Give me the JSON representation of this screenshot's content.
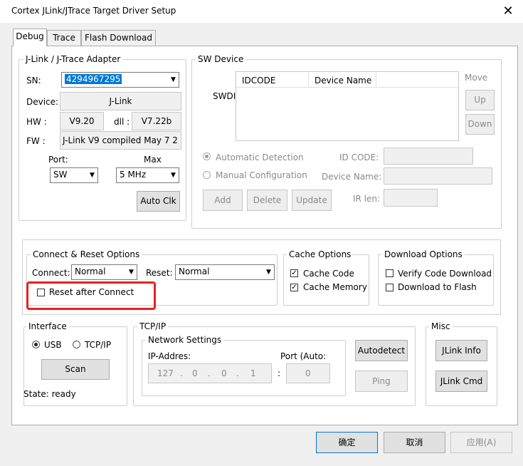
{
  "window": {
    "title": "Cortex JLink/JTrace Target Driver Setup"
  },
  "tabs": [
    {
      "label": "Debug"
    },
    {
      "label": "Trace"
    },
    {
      "label": "Flash Download"
    }
  ],
  "adapter": {
    "title": "J-Link / J-Trace Adapter",
    "sn_label": "SN:",
    "sn_value": "4294967295",
    "device_label": "Device:",
    "device_value": "J-Link",
    "hw_label": "HW :",
    "hw_value": "V9.20",
    "dll_label": "dll :",
    "dll_value": "V7.22b",
    "fw_label": "FW :",
    "fw_value": "J-Link V9 compiled May  7 2",
    "port_label": "Port:",
    "port_value": "SW",
    "max_label": "Max",
    "max_value": "5 MHz",
    "autoclk": "Auto Clk"
  },
  "sw_device": {
    "title": "SW Device",
    "swdi_label": "SWDI",
    "col_idcode": "IDCODE",
    "col_device": "Device Name",
    "move_label": "Move",
    "up": "Up",
    "down": "Down",
    "auto_detect": "Automatic Detection",
    "manual_config": "Manual Configuration",
    "id_code_label": "ID CODE:",
    "device_name_label": "Device Name:",
    "ir_len_label": "IR len:",
    "add": "Add",
    "delete": "Delete",
    "update": "Update"
  },
  "connect_reset": {
    "title": "Connect & Reset Options",
    "connect_label": "Connect:",
    "connect_value": "Normal",
    "reset_label": "Reset:",
    "reset_value": "Normal",
    "reset_after_connect": "Reset after Connect",
    "reset_after_connect_checked": false
  },
  "cache": {
    "title": "Cache Options",
    "cache_code": "Cache Code",
    "cache_code_checked": true,
    "cache_memory": "Cache Memory",
    "cache_memory_checked": true
  },
  "download": {
    "title": "Download Options",
    "verify": "Verify Code Download",
    "verify_checked": false,
    "download_flash": "Download to Flash",
    "download_flash_checked": false
  },
  "interface": {
    "title": "Interface",
    "usb": "USB",
    "tcpip": "TCP/IP",
    "selected": "USB",
    "scan": "Scan",
    "state": "State: ready"
  },
  "tcpip": {
    "title": "TCP/IP",
    "network_settings": "Network Settings",
    "ip_label": "IP-Addres:",
    "port_label": "Port (Auto:",
    "ip": [
      "127",
      "0",
      "0",
      "1"
    ],
    "port": "0",
    "autodetect": "Autodetect",
    "ping": "Ping"
  },
  "misc": {
    "title": "Misc",
    "jlink_info": "JLink Info",
    "jlink_cmd": "JLink Cmd"
  },
  "footer": {
    "ok": "确定",
    "cancel": "取消",
    "apply": "应用(A)"
  },
  "highlight_color": "#e8221b"
}
